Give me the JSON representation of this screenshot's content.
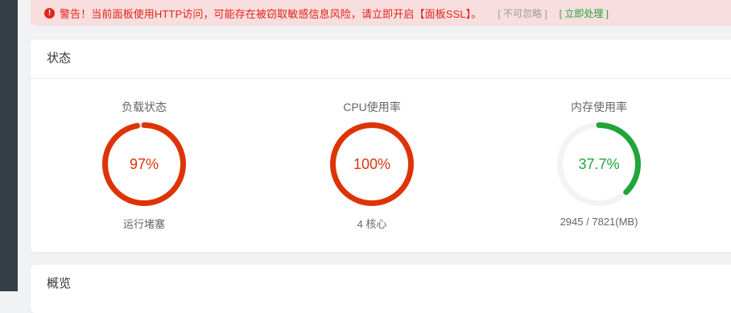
{
  "alert": {
    "icon": "exclamation-circle-icon",
    "text": "警告！当前面板使用HTTP访问，可能存在被窃取敏感信息风险，请立即开启【面板SSL】。",
    "ignore_label": "[ 不可忽略 ]",
    "fix_label": "[ 立即处理 ]",
    "colors": {
      "text": "#e2231a",
      "background": "#f8dede",
      "fix": "#20a53a",
      "ignore": "#9a9a9a"
    }
  },
  "status": {
    "title": "状态",
    "gauges": [
      {
        "title": "负载状态",
        "value_text": "97%",
        "percent": 97,
        "subtitle": "运行堵塞",
        "color": "#dd3406"
      },
      {
        "title": "CPU使用率",
        "value_text": "100%",
        "percent": 100,
        "subtitle": "4 核心",
        "color": "#dd3406"
      },
      {
        "title": "内存使用率",
        "value_text": "37.7%",
        "percent": 37.7,
        "subtitle": "2945 / 7821(MB)",
        "color": "#20a53a"
      }
    ],
    "track_color": "#f2f3f6"
  },
  "overview": {
    "title": "概览"
  }
}
